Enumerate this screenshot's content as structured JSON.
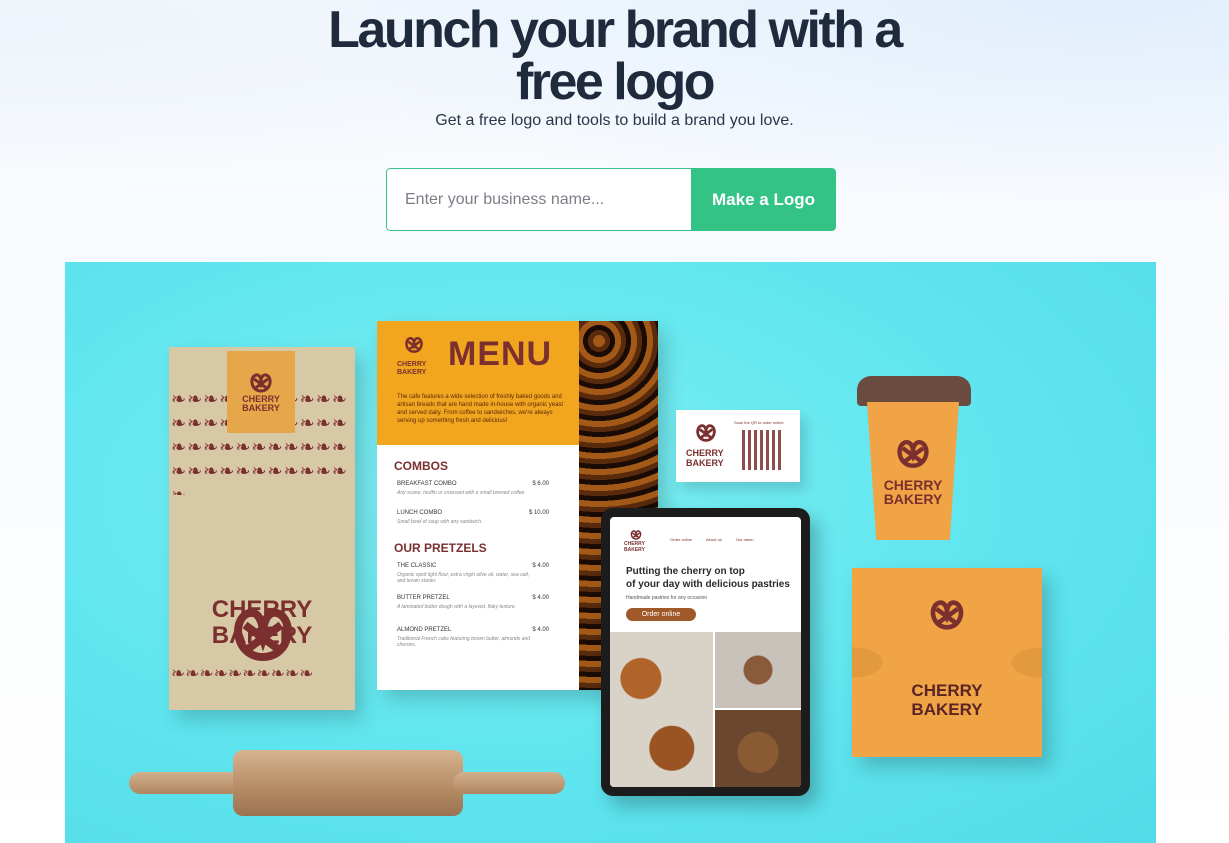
{
  "hero": {
    "title_line1": "Launch your brand with a",
    "title_line2": "free logo",
    "subtitle": "Get a free logo and tools to build a brand you love."
  },
  "form": {
    "placeholder": "Enter your business name...",
    "button_label": "Make a Logo"
  },
  "showcase": {
    "brand_line1": "CHERRY",
    "brand_line2": "BAKERY",
    "menu": {
      "title": "MENU",
      "intro": "The cafe features a wide selection of freshly baked goods and artisan breads that are hand made in-house with organic yeast and served daily. From coffee to sandwiches, we're always serving up something fresh and delicious!",
      "sections": [
        {
          "name": "COMBOS",
          "items": [
            {
              "name": "BREAKFAST COMBO",
              "price": "$ 6.00",
              "note": "Any scone, muffin or croissant with a small brewed coffee."
            },
            {
              "name": "LUNCH COMBO",
              "price": "$ 10.00",
              "note": "Small bowl of soup with any sandwich."
            }
          ]
        },
        {
          "name": "OUR PRETZELS",
          "items": [
            {
              "name": "THE CLASSIC",
              "price": "$ 4.00",
              "note": "Organic spelt light flour, extra virgin olive oil, water, sea salt, and levain starter."
            },
            {
              "name": "BUTTER PRETZEL",
              "price": "$ 4.00",
              "note": "A laminated butter dough with a layered, flaky texture."
            },
            {
              "name": "ALMOND PRETZEL",
              "price": "$ 4.00",
              "note": "Traditional French cake featuring brown butter, almonds and cherries."
            }
          ]
        }
      ]
    },
    "card": {
      "qr_caption": "Scan the QR to order online"
    },
    "tablet": {
      "nav": [
        "Order online",
        "About us",
        "Our menu"
      ],
      "headline_line1": "Putting the cherry on top",
      "headline_line2": "of your day with delicious pastries",
      "subline": "Handmade pastries for any occasion",
      "cta": "Order online"
    },
    "colors": {
      "brand": "#7b2f2f",
      "accent": "#33c387",
      "background": "#5fe5ef",
      "orange": "#f0a446"
    }
  }
}
